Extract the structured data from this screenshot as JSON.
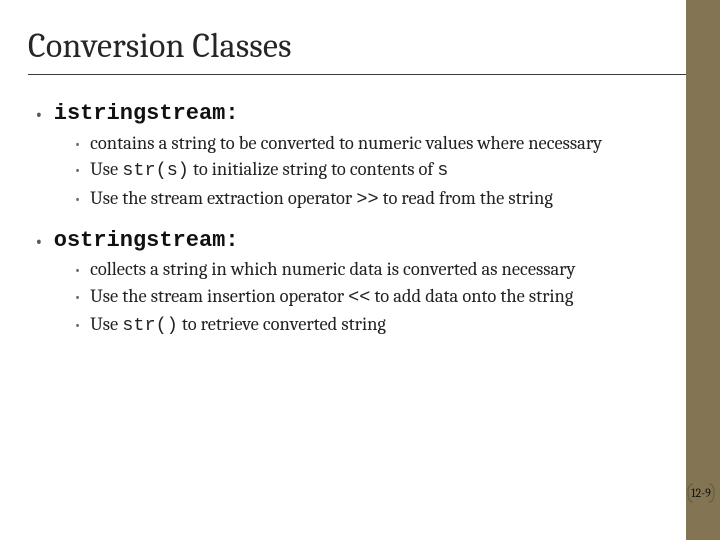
{
  "title": "Conversion Classes",
  "sections": [
    {
      "heading_code": "istringstream:",
      "items": [
        {
          "pre": "contains a string to be converted to numeric values where necessary"
        },
        {
          "pre": "Use ",
          "mono": "str(s)",
          "post": " to initialize string to contents of ",
          "mono2": "s"
        },
        {
          "pre": "Use the stream extraction operator ",
          "mono": ">>",
          "post": " to read from the string"
        }
      ]
    },
    {
      "heading_code": "ostringstream:",
      "items": [
        {
          "pre": "collects a string in which numeric data is converted as necessary"
        },
        {
          "pre": "Use the stream insertion operator ",
          "mono": "<<",
          "post": " to add data onto the string"
        },
        {
          "pre": "Use ",
          "mono": "str()",
          "post": " to retrieve converted string"
        }
      ]
    }
  ],
  "page": "12-9"
}
